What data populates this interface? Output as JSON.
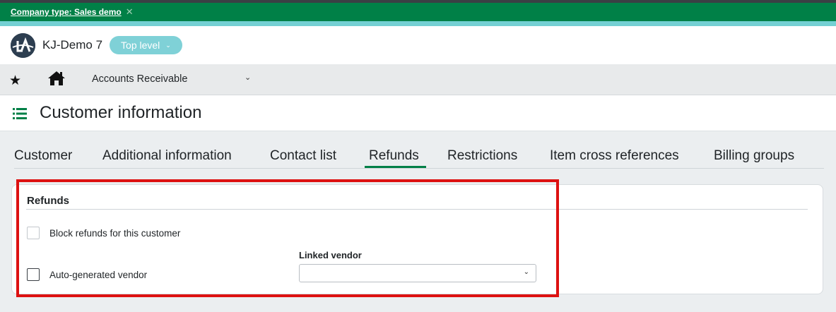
{
  "banner": {
    "company_type": "Company type: Sales demo",
    "close_glyph": "✕"
  },
  "header": {
    "company_name": "KJ-Demo 7",
    "level": "Top level",
    "logo_icon": "company-logo"
  },
  "nav": {
    "favorites_icon": "star-icon",
    "home_icon": "home-icon",
    "module": "Accounts Receivable"
  },
  "page": {
    "title": "Customer information"
  },
  "tabs": [
    {
      "label": "Customer"
    },
    {
      "label": "Additional information"
    },
    {
      "label": "Contact list"
    },
    {
      "label": "Refunds",
      "active": true
    },
    {
      "label": "Restrictions"
    },
    {
      "label": "Item cross references"
    },
    {
      "label": "Billing groups"
    }
  ],
  "refunds": {
    "section_title": "Refunds",
    "block_refunds_label": "Block refunds for this customer",
    "block_refunds_checked": false,
    "auto_vendor_label": "Auto-generated vendor",
    "auto_vendor_checked": false,
    "linked_vendor_label": "Linked vendor",
    "linked_vendor_value": ""
  },
  "colors": {
    "brand_green": "#008047",
    "teal": "#74d0d3",
    "pill": "#7fd1d7",
    "highlight_red": "#dd1111"
  }
}
